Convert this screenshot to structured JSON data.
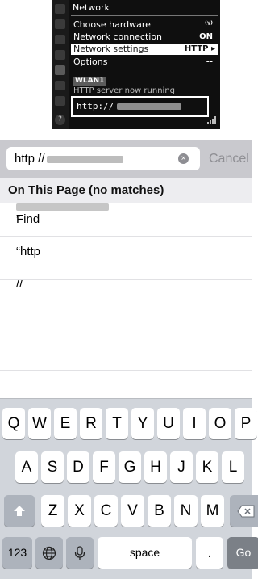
{
  "camera_menu": {
    "title": "Network",
    "rows": [
      {
        "label": "Choose hardware",
        "value": "⁽ᵞ⁾"
      },
      {
        "label": "Network connection",
        "value": "ON"
      },
      {
        "label": "Network settings",
        "value": "HTTP ▸"
      },
      {
        "label": "Options",
        "value": "--"
      }
    ],
    "badge": "WLAN1",
    "status_text": "HTTP server now running",
    "url_prefix": "http://"
  },
  "browser": {
    "search_prefix": "http //",
    "cancel_label": "Cancel",
    "section_header": "On This Page (no matches)",
    "find_prefix": "Find “http // ",
    "find_suffix": "”"
  },
  "keyboard": {
    "row1": [
      "Q",
      "W",
      "E",
      "R",
      "T",
      "Y",
      "U",
      "I",
      "O",
      "P"
    ],
    "row2": [
      "A",
      "S",
      "D",
      "F",
      "G",
      "H",
      "J",
      "K",
      "L"
    ],
    "row3": [
      "Z",
      "X",
      "C",
      "V",
      "B",
      "N",
      "M"
    ],
    "numbers_label": "123",
    "space_label": "space",
    "period_label": ".",
    "go_label": "Go"
  }
}
